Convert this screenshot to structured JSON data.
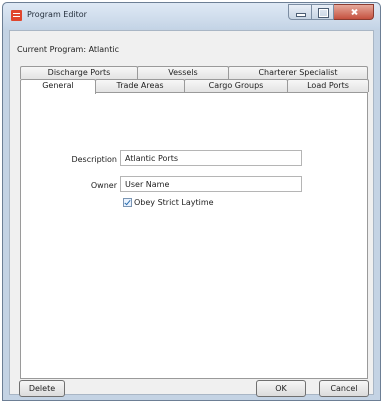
{
  "window": {
    "title": "Program Editor",
    "controls": [
      "minimize-icon",
      "maximize-icon",
      "close-icon"
    ]
  },
  "current_program": "Current Program: Atlantic",
  "tabs": {
    "back_row": [
      "Discharge Ports",
      "Vessels",
      "Charterer Specialist"
    ],
    "front_row": [
      "General",
      "Trade Areas",
      "Cargo Groups",
      "Load Ports"
    ],
    "active": "General"
  },
  "form": {
    "description_label": "Description",
    "description_value": "Atlantic Ports",
    "owner_label": "Owner",
    "owner_value": "User Name",
    "checkbox_label": "Obey Strict Laytime",
    "checkbox_checked": true
  },
  "buttons": {
    "delete": "Delete",
    "ok": "OK",
    "cancel": "Cancel"
  },
  "colors": {
    "frame": "#c4d3e4",
    "close_button": "#c5513f",
    "app_icon": "#e0462e"
  }
}
